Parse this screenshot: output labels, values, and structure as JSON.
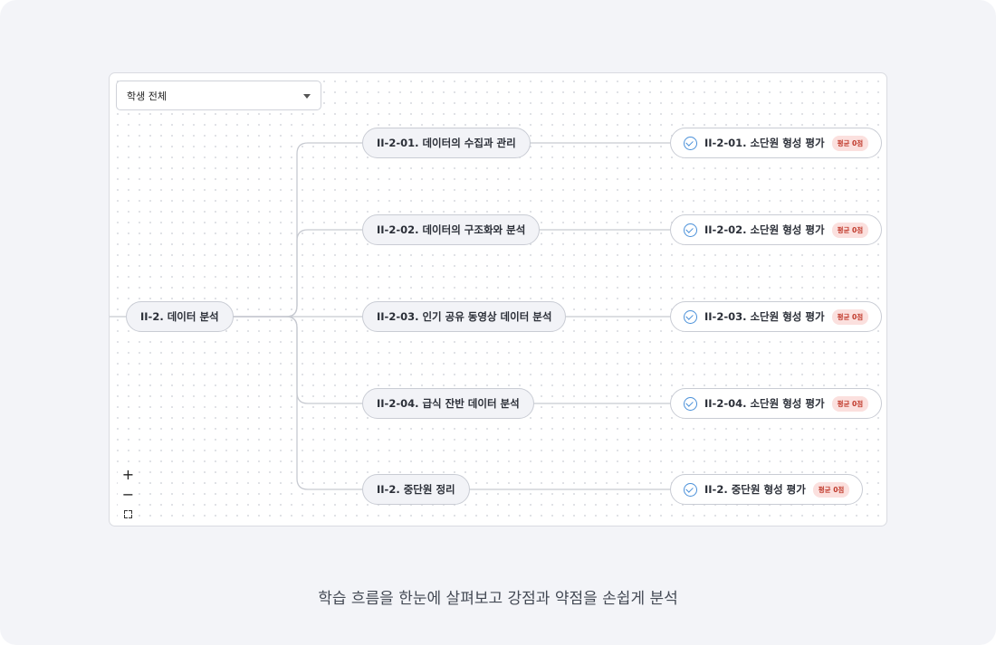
{
  "filter": {
    "selected": "학생 전체"
  },
  "tree": {
    "root": {
      "label": "II-2. 데이터 분석"
    },
    "units": [
      {
        "label": "II-2-01. 데이터의 수집과 관리",
        "eval_label": "II-2-01. 소단원 형성 평가",
        "badge": "평균 0점"
      },
      {
        "label": "II-2-02. 데이터의 구조화와 분석",
        "eval_label": "II-2-02. 소단원 형성 평가",
        "badge": "평균 0점"
      },
      {
        "label": "II-2-03. 인기 공유 동영상 데이터 분석",
        "eval_label": "II-2-03. 소단원 형성 평가",
        "badge": "평균 0점"
      },
      {
        "label": "II-2-04. 급식 잔반 데이터 분석",
        "eval_label": "II-2-04. 소단원 형성 평가",
        "badge": "평균 0점"
      },
      {
        "label": "II-2. 중단원 정리",
        "eval_label": "II-2. 중단원 형성 평가",
        "badge": "평균 0점"
      }
    ]
  },
  "zoom_controls": {
    "plus": "+",
    "minus": "−"
  },
  "caption": "학습 흐름을 한눈에 살펴보고 강점과 약점을 손쉽게 분석",
  "colors": {
    "check": "#4a90d9",
    "badge_bg": "#fbe0de",
    "badge_text": "#c0392b",
    "edge": "#c7cad1"
  },
  "icons": {
    "check": "check-circle-icon",
    "dropdown": "chevron-down-icon",
    "fit": "fit-view-icon"
  }
}
